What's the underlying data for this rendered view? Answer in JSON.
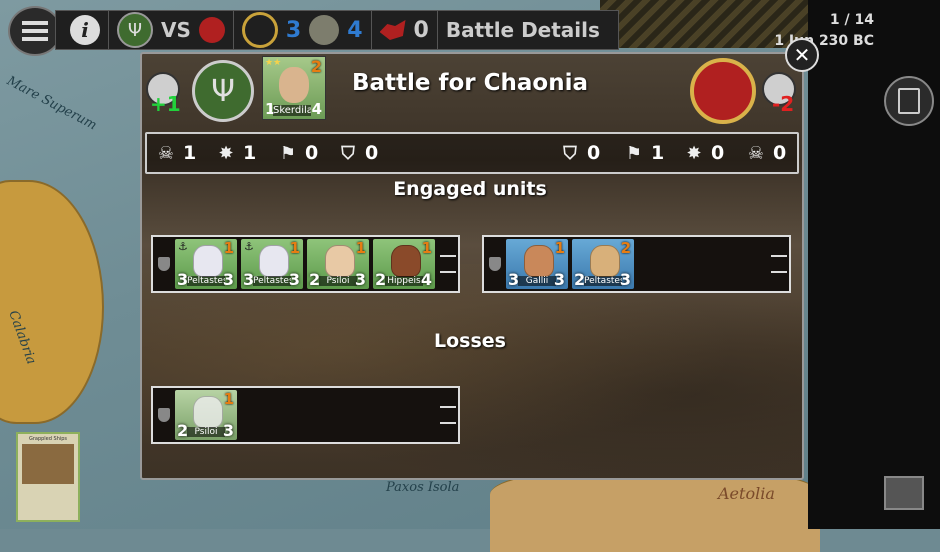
{
  "topbar": {
    "vs_label": "VS",
    "player_score": "3",
    "enemy_score": "4",
    "reinforcements": "0",
    "battle_details_label": "Battle Details",
    "player_color": "#2f7bd1",
    "enemy_color": "#2f7bd1"
  },
  "turn": {
    "counter": "1 / 14",
    "date": "1 Jun 230 BC"
  },
  "map": {
    "labels": [
      "Mare Superum",
      "Calabria",
      "Paxos Isola",
      "Aetolia"
    ]
  },
  "battle": {
    "title": "Battle for Chaonia",
    "attacker_modifier": "+1",
    "defender_modifier": "-2",
    "commander": {
      "name": "Skerdilaid",
      "level": "2",
      "attack": "1",
      "defense": "4"
    },
    "stats_left": {
      "casualties": "1",
      "routed": "1",
      "flags": "0",
      "shields": "0"
    },
    "stats_right": {
      "shields": "0",
      "flags": "1",
      "routed": "0",
      "casualties": "0"
    },
    "engaged_header": "Engaged units",
    "losses_header": "Losses",
    "attacker_units": [
      {
        "name": "Peltastes",
        "level": "1",
        "attack": "3",
        "defense": "3",
        "naval": true
      },
      {
        "name": "Peltastes",
        "level": "1",
        "attack": "3",
        "defense": "3",
        "naval": true
      },
      {
        "name": "Psiloi",
        "level": "1",
        "attack": "2",
        "defense": "3",
        "naval": false
      },
      {
        "name": "Hippeis",
        "level": "1",
        "attack": "2",
        "defense": "4",
        "naval": false
      }
    ],
    "defender_units": [
      {
        "name": "Gallii",
        "level": "1",
        "attack": "3",
        "defense": "3"
      },
      {
        "name": "Peltastes",
        "level": "2",
        "attack": "2",
        "defense": "3"
      }
    ],
    "losses": [
      {
        "name": "Psiloi",
        "level": "1",
        "attack": "2",
        "defense": "3"
      }
    ]
  },
  "side_card": {
    "title": "Grappled Ships"
  }
}
